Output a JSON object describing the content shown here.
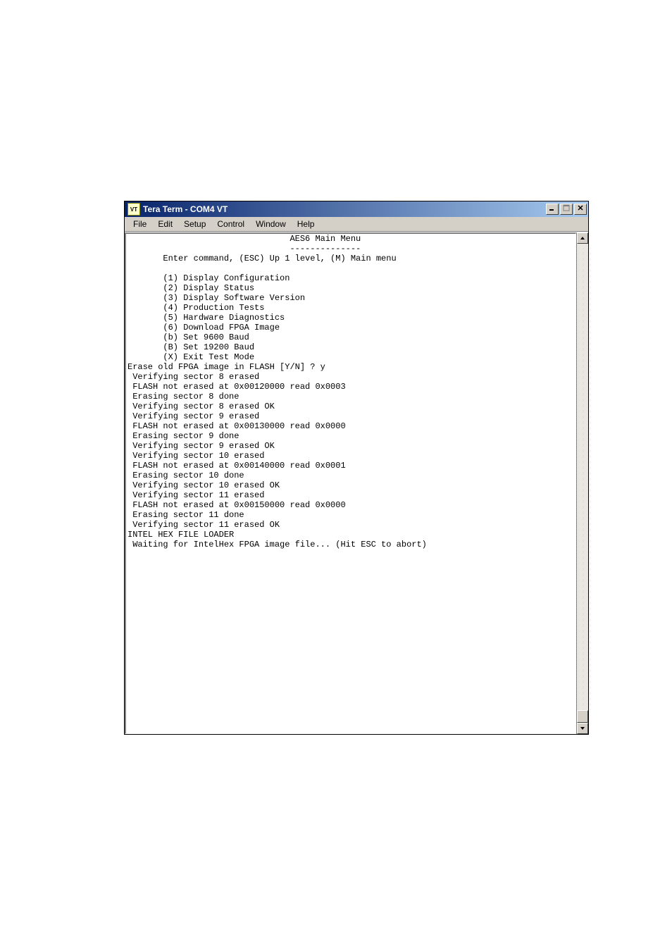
{
  "window": {
    "title": "Tera Term - COM4 VT",
    "icon_label": "VT"
  },
  "menubar": {
    "items": [
      "File",
      "Edit",
      "Setup",
      "Control",
      "Window",
      "Help"
    ]
  },
  "colors": {
    "titlebar_start": "#08246b",
    "titlebar_end": "#a6caf0",
    "chrome": "#d4d0c8",
    "terminal_bg": "#ffffff",
    "terminal_fg": "#000000"
  },
  "terminal": {
    "header_title": "                                AES6 Main Menu",
    "header_rule": "                                --------------",
    "prompt": "       Enter command, (ESC) Up 1 level, (M) Main menu",
    "menu_items": [
      "       (1) Display Configuration",
      "       (2) Display Status",
      "       (3) Display Software Version",
      "       (4) Production Tests",
      "       (5) Hardware Diagnostics",
      "       (6) Download FPGA Image",
      "       (b) Set 9600 Baud",
      "       (B) Set 19200 Baud",
      "       (X) Exit Test Mode"
    ],
    "log_lines": [
      "Erase old FPGA image in FLASH [Y/N] ? y",
      " Verifying sector 8 erased",
      " FLASH not erased at 0x00120000 read 0x0003",
      " Erasing sector 8 done",
      " Verifying sector 8 erased OK",
      " Verifying sector 9 erased",
      " FLASH not erased at 0x00130000 read 0x0000",
      " Erasing sector 9 done",
      " Verifying sector 9 erased OK",
      " Verifying sector 10 erased",
      " FLASH not erased at 0x00140000 read 0x0001",
      " Erasing sector 10 done",
      " Verifying sector 10 erased OK",
      " Verifying sector 11 erased",
      " FLASH not erased at 0x00150000 read 0x0000",
      " Erasing sector 11 done",
      " Verifying sector 11 erased OK",
      "INTEL HEX FILE LOADER",
      " Waiting for IntelHex FPGA image file... (Hit ESC to abort)"
    ]
  },
  "buttons": {
    "minimize": "minimize",
    "maximize": "maximize",
    "close": "close",
    "scroll_up": "scroll-up",
    "scroll_down": "scroll-down"
  }
}
